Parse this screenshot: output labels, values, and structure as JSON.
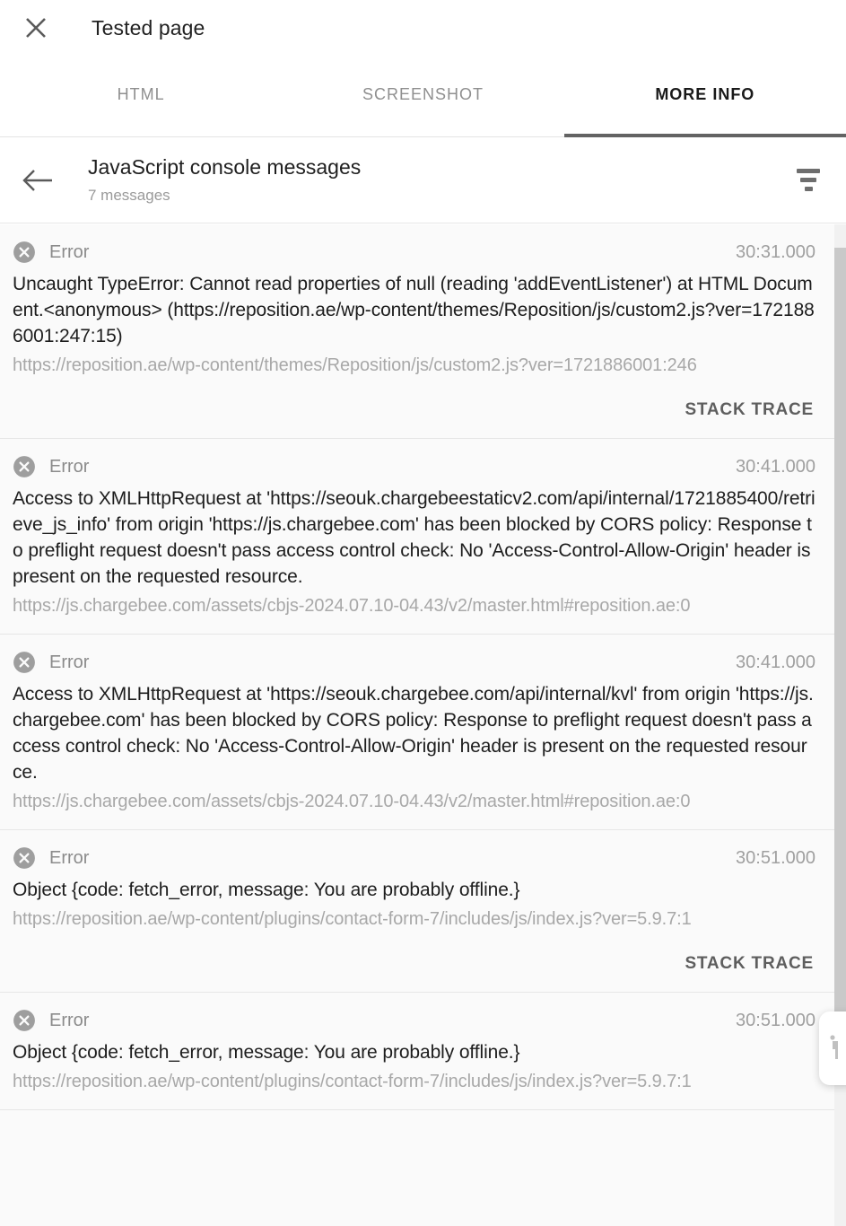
{
  "window": {
    "title": "Tested page",
    "close_icon": "close-icon"
  },
  "tabs": [
    {
      "label": "HTML",
      "active": false
    },
    {
      "label": "SCREENSHOT",
      "active": false
    },
    {
      "label": "MORE INFO",
      "active": true
    }
  ],
  "subheader": {
    "back_icon": "arrow-left-icon",
    "title": "JavaScript console messages",
    "count_text": "7 messages",
    "filter_icon": "filter-icon"
  },
  "stack_trace_label": "STACK TRACE",
  "messages": [
    {
      "level": "Error",
      "level_icon": "error-circle-x-icon",
      "time": "30:31.000",
      "text": "Uncaught TypeError: Cannot read properties of null (reading 'addEventListener') at HTML Document.<anonymous> (https://reposition.ae/wp-content/themes/Reposition/js/custom2.js?ver=1721886001:247:15)",
      "url": "https://reposition.ae/wp-content/themes/Reposition/js/custom2.js?ver=1721886001:246",
      "has_stack_trace": true
    },
    {
      "level": "Error",
      "level_icon": "error-circle-x-icon",
      "time": "30:41.000",
      "text": "Access to XMLHttpRequest at 'https://seouk.chargebeestaticv2.com/api/internal/1721885400/retrieve_js_info' from origin 'https://js.chargebee.com' has been blocked by CORS policy: Response to preflight request doesn't pass access control check: No 'Access-Control-Allow-Origin' header is present on the requested resource.",
      "url": "https://js.chargebee.com/assets/cbjs-2024.07.10-04.43/v2/master.html#reposition.ae:0",
      "has_stack_trace": false
    },
    {
      "level": "Error",
      "level_icon": "error-circle-x-icon",
      "time": "30:41.000",
      "text": "Access to XMLHttpRequest at 'https://seouk.chargebee.com/api/internal/kvl' from origin 'https://js.chargebee.com' has been blocked by CORS policy: Response to preflight request doesn't pass access control check: No 'Access-Control-Allow-Origin' header is present on the requested resource.",
      "url": "https://js.chargebee.com/assets/cbjs-2024.07.10-04.43/v2/master.html#reposition.ae:0",
      "has_stack_trace": false
    },
    {
      "level": "Error",
      "level_icon": "error-circle-x-icon",
      "time": "30:51.000",
      "text": "Object {code: fetch_error, message: You are probably offline.}",
      "url": "https://reposition.ae/wp-content/plugins/contact-form-7/includes/js/index.js?ver=5.9.7:1",
      "has_stack_trace": true
    },
    {
      "level": "Error",
      "level_icon": "error-circle-x-icon",
      "time": "30:51.000",
      "text": "Object {code: fetch_error, message: You are probably offline.}",
      "url": "https://reposition.ae/wp-content/plugins/contact-form-7/includes/js/index.js?ver=5.9.7:1",
      "has_stack_trace": false
    }
  ],
  "colors": {
    "background": "#ffffff",
    "list_background": "#fafafa",
    "active_tab_underline": "#636363",
    "error_icon": "#9e9e9e",
    "muted_text": "#a0a0a0",
    "body_text": "#1d1d1d"
  }
}
